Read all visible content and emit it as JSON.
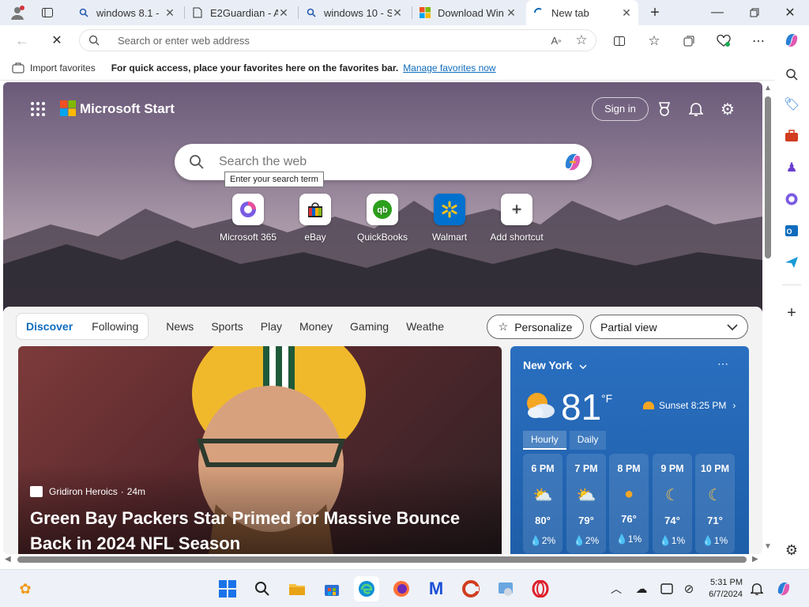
{
  "tabs": [
    {
      "label": "windows 8.1 -",
      "icon": "search-icon"
    },
    {
      "label": "E2Guardian - A",
      "icon": "page-icon"
    },
    {
      "label": "windows 10 - S",
      "icon": "search-icon"
    },
    {
      "label": "Download Win",
      "icon": "microsoft-icon"
    },
    {
      "label": "New tab",
      "icon": "loading-icon"
    }
  ],
  "address_bar": {
    "placeholder": "Search or enter web address"
  },
  "favorites_bar": {
    "import_label": "Import favorites",
    "hint": "For quick access, place your favorites here on the favorites bar.",
    "manage_link": "Manage favorites now"
  },
  "start": {
    "brand": "Microsoft Start",
    "sign_in": "Sign in",
    "search_placeholder": "Search the web",
    "search_tooltip": "Enter your search term",
    "shortcuts": [
      {
        "label": "Microsoft 365"
      },
      {
        "label": "eBay"
      },
      {
        "label": "QuickBooks"
      },
      {
        "label": "Walmart"
      },
      {
        "label": "Add shortcut"
      }
    ]
  },
  "feed_nav": {
    "tabs": [
      "Discover",
      "Following",
      "News",
      "Sports",
      "Play",
      "Money",
      "Gaming",
      "Weathe"
    ],
    "personalize": "Personalize",
    "view_select": "Partial view"
  },
  "article": {
    "source": "Gridiron Heroics",
    "age": "24m",
    "headline": "Green Bay Packers Star Primed for Massive Bounce Back in 2024 NFL Season"
  },
  "weather": {
    "location": "New York",
    "temp": "81",
    "unit": "°F",
    "sunset": "Sunset 8:25 PM",
    "tabs": [
      "Hourly",
      "Daily"
    ],
    "hours": [
      {
        "time": "6 PM",
        "temp": "80°",
        "precip": "2%"
      },
      {
        "time": "7 PM",
        "temp": "79°",
        "precip": "2%"
      },
      {
        "time": "8 PM",
        "temp": "76°",
        "precip": "1%"
      },
      {
        "time": "9 PM",
        "temp": "74°",
        "precip": "1%"
      },
      {
        "time": "10 PM",
        "temp": "71°",
        "precip": "1%"
      }
    ]
  },
  "clock": {
    "time": "5:31 PM",
    "date": "6/7/2024"
  },
  "colors": {
    "accent": "#0f6cbd",
    "weather_bg": "#1f6fbf"
  }
}
